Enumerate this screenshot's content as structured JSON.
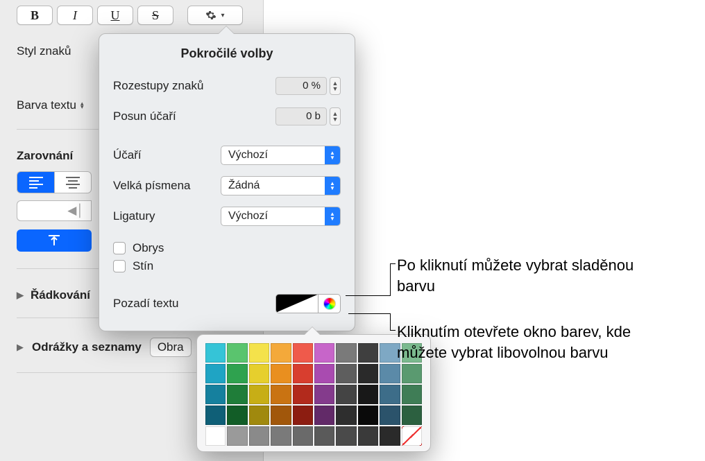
{
  "sidebar": {
    "char_style_label": "Styl znaků",
    "text_color_label": "Barva textu",
    "alignment_label": "Zarovnání",
    "line_spacing_label": "Řádkování",
    "bullets_label": "Odrážky a seznamy",
    "bullets_chip": "Obra"
  },
  "popover": {
    "title": "Pokročilé volby",
    "char_spacing_label": "Rozestupy znaků",
    "char_spacing_value": "0 %",
    "baseline_shift_label": "Posun účaří",
    "baseline_shift_value": "0 b",
    "baseline_label": "Účaří",
    "baseline_value": "Výchozí",
    "caps_label": "Velká písmena",
    "caps_value": "Žádná",
    "ligatures_label": "Ligatury",
    "ligatures_value": "Výchozí",
    "outline_label": "Obrys",
    "shadow_label": "Stín",
    "text_background_label": "Pozadí textu"
  },
  "callouts": {
    "well": "Po kliknutí můžete vybrat sladěnou barvu",
    "wheel": "Kliknutím otevřete okno barev, kde můžete vybrat libovolnou barvu"
  },
  "palette_colors": [
    [
      "#35c4d7",
      "#5ac46e",
      "#f4e24b",
      "#f4a93a",
      "#ef5a4b",
      "#c765c9",
      "#7a7a7a",
      "#3f3f3f",
      "#7ea8c4",
      "#7bb98e"
    ],
    [
      "#1fa4c4",
      "#2fa24f",
      "#e6cf2d",
      "#e98f1f",
      "#d83e2f",
      "#a94bb0",
      "#5e5e5e",
      "#2a2a2a",
      "#5b8aa8",
      "#5a9a70"
    ],
    [
      "#15809e",
      "#1f7d39",
      "#c7ae16",
      "#c97312",
      "#b22a1c",
      "#843b8c",
      "#444444",
      "#181818",
      "#3d6d89",
      "#3f7d56"
    ],
    [
      "#0f5f77",
      "#125d27",
      "#a0890e",
      "#a1570b",
      "#8c1d11",
      "#622a68",
      "#2e2e2e",
      "#0a0a0a",
      "#2b536b",
      "#2c6040"
    ],
    [
      "#ffffff",
      "#9a9a9a",
      "#8a8a8a",
      "#7a7a7a",
      "#6a6a6a",
      "#5a5a5a",
      "#4a4a4a",
      "#3a3a3a",
      "#2a2a2a",
      "none"
    ]
  ]
}
